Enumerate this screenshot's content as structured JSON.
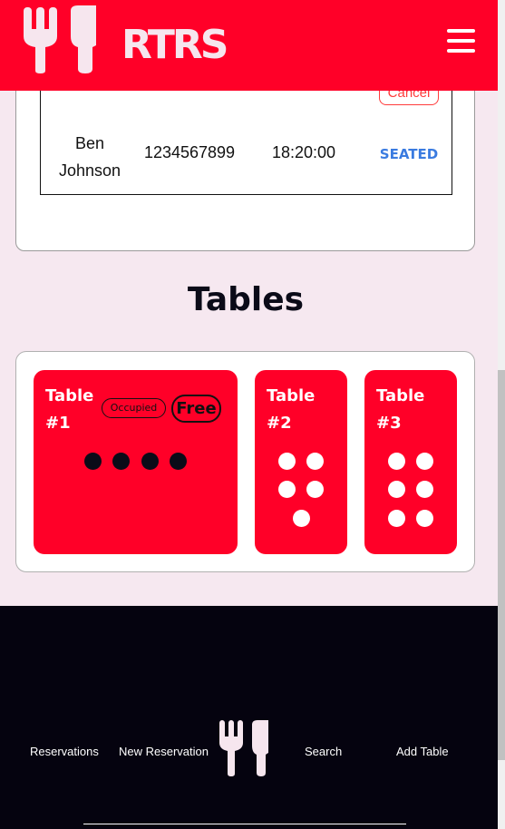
{
  "brand": {
    "logo_text": "RTRS"
  },
  "header": {
    "menu_icon": "hamburger-menu-icon"
  },
  "reservations": {
    "cancel_label": "Cancel",
    "row": {
      "name_first": "Ben",
      "name_last": "Johnson",
      "phone": "1234567899",
      "time": "18:20:00",
      "status": "SEATED"
    }
  },
  "tables_section": {
    "heading": "Tables",
    "tables": [
      {
        "label_line1": "Table",
        "label_line2": "#1",
        "occupied_label": "Occupied",
        "free_label": "Free",
        "seats": 4
      },
      {
        "label_line1": "Table",
        "label_line2": "#2",
        "seats": 5
      },
      {
        "label_line1": "Table",
        "label_line2": "#3",
        "seats": 6
      }
    ]
  },
  "footer": {
    "links": [
      "Reservations",
      "New Reservation",
      "Search",
      "Add Table"
    ]
  },
  "colors": {
    "brand_red": "#ff0028",
    "page_bg": "#f6e8f0",
    "footer_bg": "#05030f",
    "status_blue": "#3a7be0"
  }
}
